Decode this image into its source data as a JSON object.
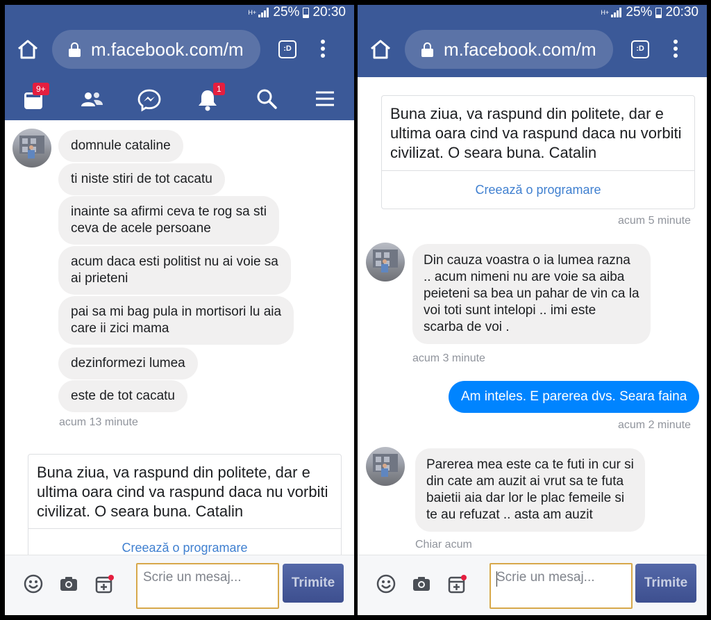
{
  "status_bar": {
    "network": "H+",
    "battery": "25%",
    "time": "20:30"
  },
  "browser": {
    "url": "m.facebook.com/m",
    "reader_label": ":D"
  },
  "fb_nav": {
    "feed_badge": "9+",
    "notifications_badge": "1"
  },
  "composer": {
    "placeholder": "Scrie un mesaj...",
    "send_label": "Trimite"
  },
  "left": {
    "messages": [
      "domnule cataline",
      "ti niste stiri de tot cacatu",
      "inainte sa afirmi ceva te rog sa sti\nceva de acele persoane",
      "acum daca esti politist nu ai voie sa\nai prieteni",
      "pai sa mi bag pula in mortisori lu aia\ncare ii  zici mama",
      "dezinformezi lumea",
      "este de tot cacatu"
    ],
    "time_1": "acum 13 minute",
    "card_text": "Buna ziua, va raspund din politete, dar e ultima oara cind va raspund daca nu vorbiti civilizat. O seara buna. Catalin",
    "card_link": "Creează o programare"
  },
  "right": {
    "card_text": "Buna ziua, va raspund din politete, dar e ultima oara cind va raspund daca nu vorbiti civilizat. O seara buna. Catalin",
    "card_link": "Creează o programare",
    "time_card": "acum 5 minute",
    "msg_1": "Din cauza voastra o ia lumea razna\n .. acum nimeni nu are voie sa aiba\npeieteni sa bea un pahar de vin ca la\nvoi toti sunt intelopi .. imi este\nscarba de voi .",
    "time_1": "acum 3 minute",
    "msg_out": "Am inteles. E parerea dvs. Seara faina",
    "time_out": "acum 2 minute",
    "msg_2": "Parerea mea este ca te futi in cur si\ndin cate am auzit ai vrut sa te futa\nbaietii aia dar lor le plac femeile si\nte au refuzat .. asta am auzit",
    "time_2": "Chiar acum"
  },
  "colors": {
    "facebook_blue": "#3b5998",
    "messenger_blue": "#0084ff",
    "badge_red": "#e41e3f",
    "link_blue": "#4080d0",
    "input_border": "#d7a84a"
  },
  "icons": [
    "home-icon",
    "lock-icon",
    "reader-mode-icon",
    "more-vert-icon",
    "feed-icon",
    "friends-icon",
    "messenger-icon",
    "bell-icon",
    "search-icon",
    "menu-icon",
    "emoji-icon",
    "camera-icon",
    "sticker-icon"
  ]
}
